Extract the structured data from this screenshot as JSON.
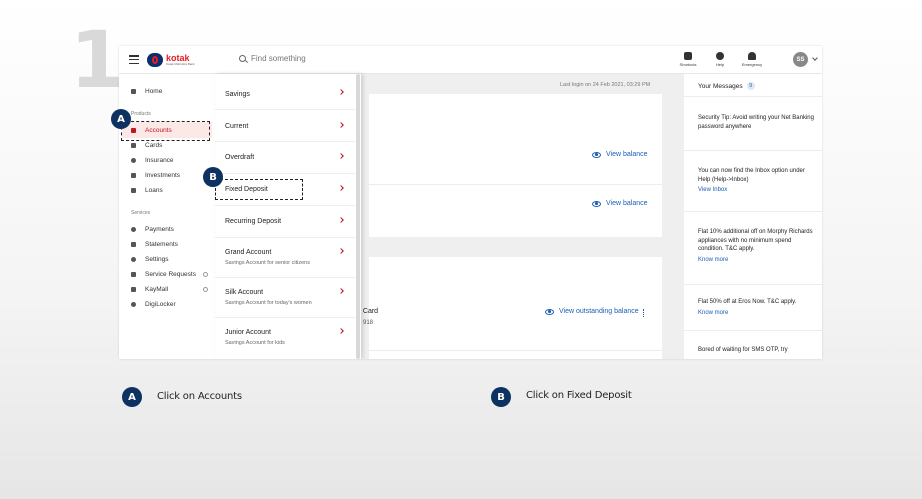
{
  "step": {
    "number": "1"
  },
  "header": {
    "logo_name": "kotak",
    "logo_sub": "Kotak Mahindra Bank",
    "search_placeholder": "Find something",
    "icons": [
      {
        "name": "shortcuts-icon",
        "label": "Shortcuts"
      },
      {
        "name": "help-icon",
        "label": "Help"
      },
      {
        "name": "emergency-icon",
        "label": "Emergency"
      }
    ],
    "avatar_initials": "SS"
  },
  "sidebar": {
    "home": "Home",
    "products_label": "Products",
    "products": [
      "Accounts",
      "Cards",
      "Insurance",
      "Investments",
      "Loans"
    ],
    "services_label": "Services",
    "services": [
      "Payments",
      "Statements",
      "Settings",
      "Service Requests",
      "KayMall",
      "DigiLocker"
    ]
  },
  "dropdown": {
    "items": [
      {
        "label": "Savings",
        "sub": ""
      },
      {
        "label": "Current",
        "sub": ""
      },
      {
        "label": "Overdraft",
        "sub": ""
      },
      {
        "label": "Fixed Deposit",
        "sub": ""
      },
      {
        "label": "Recurring Deposit",
        "sub": ""
      },
      {
        "label": "Grand Account",
        "sub": "Savings Account for senior citizens"
      },
      {
        "label": "Silk Account",
        "sub": "Savings Account for today's women"
      },
      {
        "label": "Junior Account",
        "sub": "Savings Account for kids"
      }
    ]
  },
  "main": {
    "last_login": "Last login on 24 Feb 2021, 03:29 PM",
    "view_balance_1": "View balance",
    "view_balance_2": "View balance",
    "card_title": "t Card",
    "card_number": "918",
    "view_outstanding": "View outstanding balance"
  },
  "messages": {
    "title": "Your Messages",
    "count": "9",
    "items": [
      {
        "text": "Security Tip: Avoid writing your Net Banking password anywhere",
        "link": ""
      },
      {
        "text": "You can now find the Inbox option under Help (Help->Inbox)",
        "link": "View Inbox"
      },
      {
        "text": "Flat 10% additional off on Morphy Richards appliances with no minimum spend condition. T&C apply.",
        "link": "Know more"
      },
      {
        "text": "Flat 50% off at Eros Now. T&C apply.",
        "link": "Know more"
      },
      {
        "text": "Bored of waiting for SMS OTP, try",
        "link": ""
      }
    ]
  },
  "callouts": [
    {
      "badge": "A",
      "caption": "Click on Accounts"
    },
    {
      "badge": "B",
      "caption": "Click on Fixed Deposit"
    }
  ],
  "colors": {
    "accent": "#c0171f",
    "brand_blue": "#0d3262",
    "link": "#1a5fb4"
  }
}
